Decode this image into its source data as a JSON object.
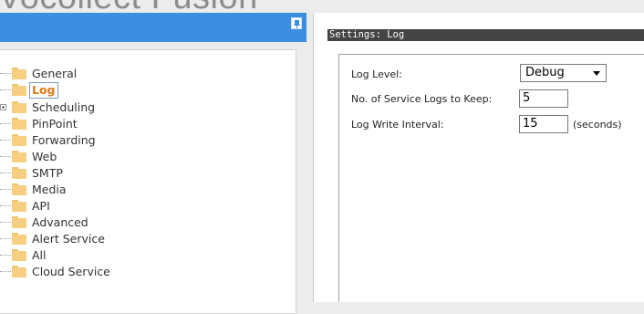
{
  "app": {
    "title": "Vocollect Fusion"
  },
  "tree": {
    "items": [
      {
        "label": "General",
        "expandable": false,
        "selected": false
      },
      {
        "label": "Log",
        "expandable": false,
        "selected": true
      },
      {
        "label": "Scheduling",
        "expandable": true,
        "selected": false
      },
      {
        "label": "PinPoint",
        "expandable": false,
        "selected": false
      },
      {
        "label": "Forwarding",
        "expandable": false,
        "selected": false
      },
      {
        "label": "Web",
        "expandable": false,
        "selected": false
      },
      {
        "label": "SMTP",
        "expandable": false,
        "selected": false
      },
      {
        "label": "Media",
        "expandable": false,
        "selected": false
      },
      {
        "label": "API",
        "expandable": false,
        "selected": false
      },
      {
        "label": "Advanced",
        "expandable": false,
        "selected": false
      },
      {
        "label": "Alert Service",
        "expandable": false,
        "selected": false
      },
      {
        "label": "All",
        "expandable": false,
        "selected": false
      },
      {
        "label": "Cloud Service",
        "expandable": false,
        "selected": false
      }
    ]
  },
  "settings": {
    "title": "Settings: Log",
    "log_level": {
      "label": "Log Level:",
      "value": "Debug"
    },
    "logs_to_keep": {
      "label": "No. of Service Logs to Keep:",
      "value": "5"
    },
    "write_interval": {
      "label": "Log Write Interval:",
      "value": "15",
      "unit": "(seconds)"
    }
  },
  "colors": {
    "header_blue": "#3b8ee0",
    "selected_text": "#e07b1a",
    "folder": "#f6cf83",
    "settings_bar": "#444444"
  },
  "icons": {
    "pin": "pin-icon",
    "folder": "folder-icon",
    "expand": "expand-plus-icon",
    "dropdown": "chevron-down-icon"
  }
}
